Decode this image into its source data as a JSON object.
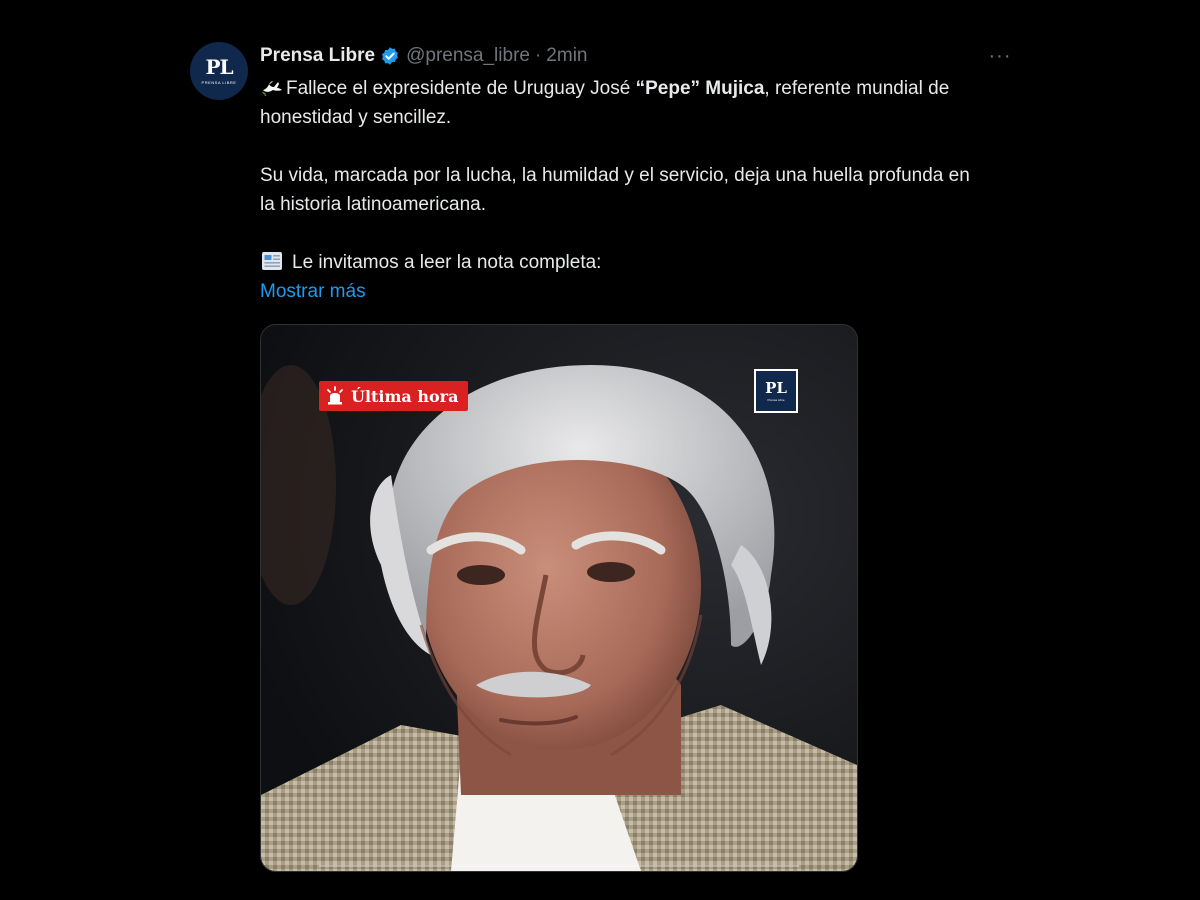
{
  "account": {
    "display_name": "Prensa Libre",
    "handle": "@prensa_libre",
    "separator": "·",
    "time": "2min",
    "avatar_text": "PL",
    "avatar_subtext": "Prensa Libre",
    "verified_color": "#1d9bf0"
  },
  "menu": {
    "more_label": "···"
  },
  "tweet": {
    "line1_prefix": "Fallece el expresidente de Uruguay José ",
    "line1_bold": "“Pepe” Mujica",
    "line1_suffix": ", referente mundial de honestidad y sencillez.",
    "paragraph2": "Su vida, marcada por la lucha, la humildad y el servicio, deja una huella profunda en la historia latinoamericana.",
    "paragraph3": "Le invitamos a leer la nota completa:",
    "show_more": "Mostrar más",
    "emoji_1": "dove-icon",
    "emoji_2": "newspaper-icon"
  },
  "media": {
    "badge_label": "Última hora",
    "badge_icon": "siren-icon",
    "badge_color": "#d92121",
    "logo_text": "PL",
    "logo_subtext": "Prensa Libre",
    "subject": "portrait-photo"
  },
  "colors": {
    "background": "#000000",
    "text": "#e7e9ea",
    "muted": "#71767b",
    "link": "#1d9bf0",
    "brand_navy": "#10284c"
  }
}
